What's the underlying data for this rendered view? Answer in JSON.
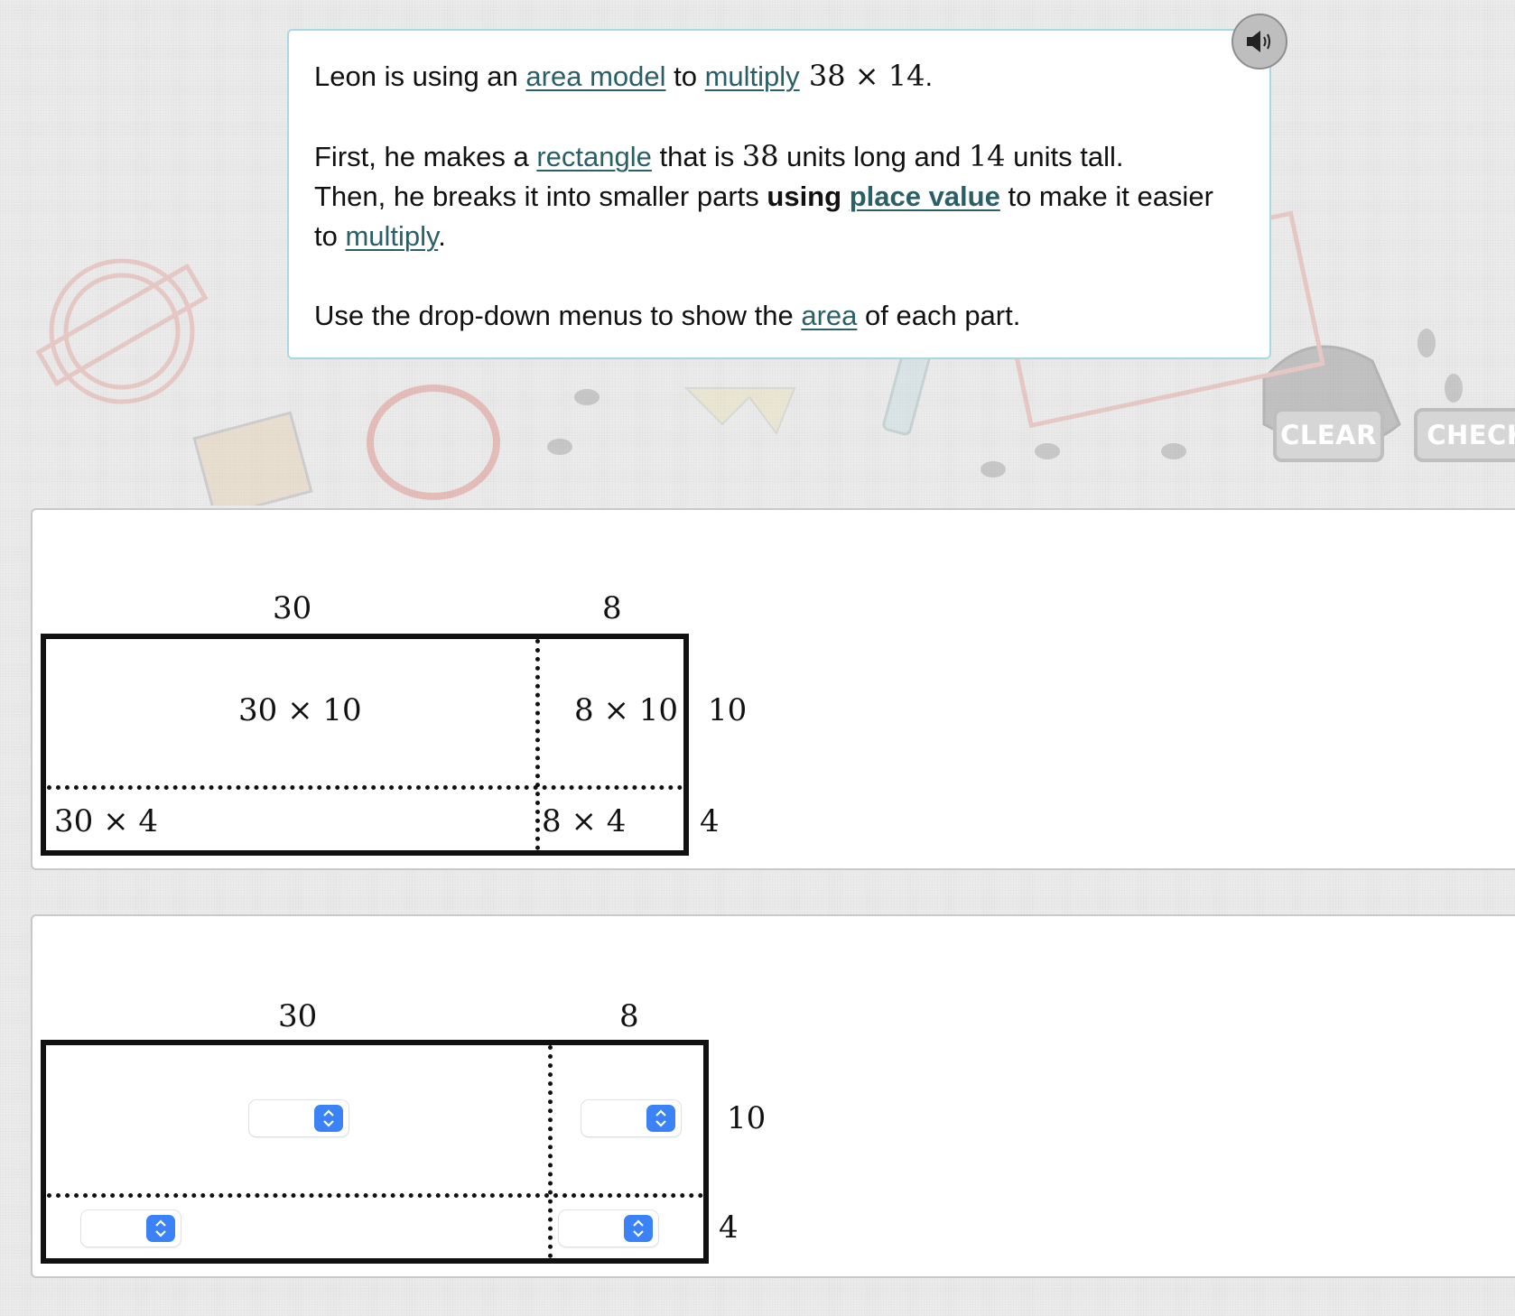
{
  "question": {
    "line1": {
      "pre": "Leon is using an ",
      "link1": "area model",
      "mid": " to ",
      "link2": "multiply",
      "math": " 38 × 14",
      "end": "."
    },
    "line2": {
      "pre": "First, he makes a ",
      "link": "rectangle",
      "t1": " that is ",
      "m1": "38",
      "t2": " units long and ",
      "m2": "14",
      "t3": " units tall."
    },
    "line3": {
      "pre": "Then, he breaks it into smaller parts ",
      "bold": "using",
      "sp": " ",
      "link": "place value",
      "post": " to make it easier to ",
      "link2": "multiply",
      "end": "."
    },
    "line4": {
      "pre": "Use the drop-down menus to show the ",
      "link": "area",
      "post": " of each part."
    },
    "speaker_icon": "speaker-icon"
  },
  "buttons": {
    "clear_label": "CLEAR",
    "check_label": "CHECK"
  },
  "model_example": {
    "top_labels": [
      "30",
      "8"
    ],
    "side_labels": [
      "10",
      "4"
    ],
    "cells": {
      "top_left": "30 × 10",
      "top_right": "8 × 10",
      "bottom_left": "30 × 4",
      "bottom_right": "8 × 4"
    }
  },
  "model_answer": {
    "top_labels": [
      "30",
      "8"
    ],
    "side_labels": [
      "10",
      "4"
    ],
    "dropdowns": {
      "top_left": "",
      "top_right": "",
      "bottom_left": "",
      "bottom_right": ""
    }
  },
  "colors": {
    "link": "#2a5f66",
    "question_border": "#a8d8e2",
    "dropdown_accent": "#3b82f6",
    "button_bg": "#d5d6d5"
  }
}
